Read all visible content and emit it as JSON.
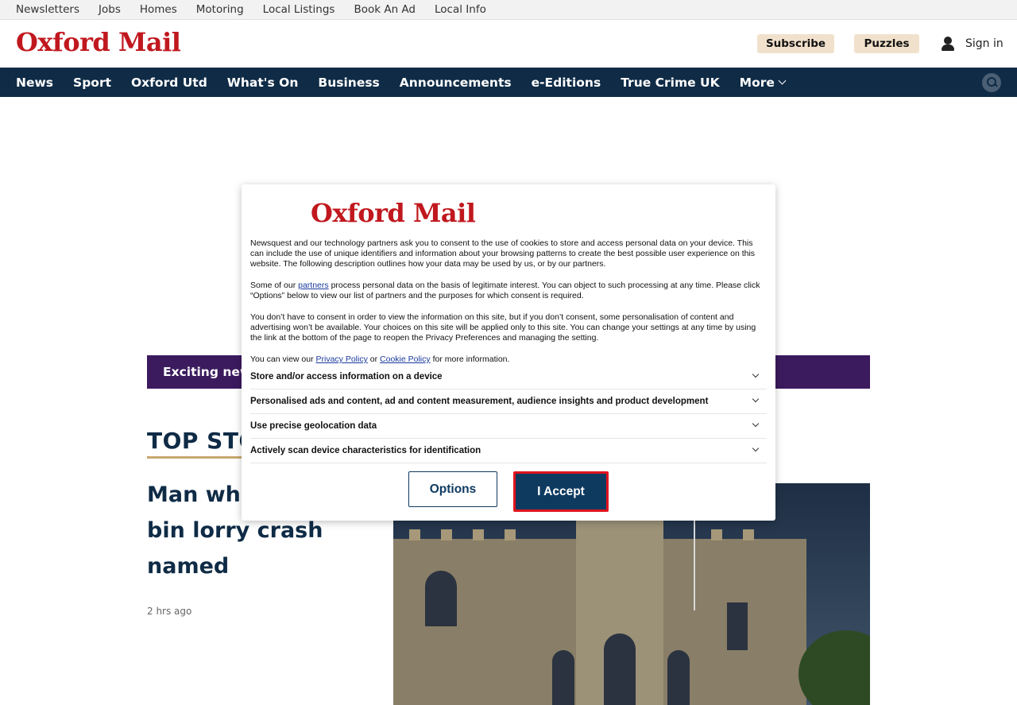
{
  "utility_nav": [
    "Newsletters",
    "Jobs",
    "Homes",
    "Motoring",
    "Local Listings",
    "Book An Ad",
    "Local Info"
  ],
  "header": {
    "logo": "Oxford Mail",
    "subscribe_label": "Subscribe",
    "puzzles_label": "Puzzles",
    "signin_label": "Sign in"
  },
  "main_nav": {
    "items": [
      "News",
      "Sport",
      "Oxford Utd",
      "What's On",
      "Business",
      "Announcements",
      "e-Editions",
      "True Crime UK"
    ],
    "more_label": "More"
  },
  "banner": {
    "text": "Exciting new"
  },
  "top_stories": {
    "title": "TOP STO",
    "headline": "Man who bin lorry crash named",
    "headline_line1": "Man who",
    "headline_line2": "bin lorry crash",
    "headline_line3": "named",
    "timestamp": "2 hrs ago"
  },
  "consent": {
    "logo": "Oxford Mail",
    "para1": "Newsquest and our technology partners ask you to consent to the use of cookies to store and access personal data on your device. This can include the use of unique identifiers and information about your browsing patterns to create the best possible user experience on this website. The following description outlines how your data may be used by us, or by our partners.",
    "para2_before": "Some of our ",
    "para2_link": "partners",
    "para2_after": " process personal data on the basis of legitimate interest. You can object to such processing at any time. Please click “Options” below to view our list of partners and the purposes for which consent is required.",
    "para3": "You don’t have to consent in order to view the information on this site, but if you don’t consent, some personalisation of content and advertising won’t be available. Your choices on this site will be applied only to this site. You can change your settings at any time by using the link at the bottom of the page to reopen the Privacy Preferences and managing the setting.",
    "para4_before": "You can view our ",
    "privacy_link": "Privacy Policy",
    "para4_or": " or ",
    "cookie_link": "Cookie Policy",
    "para4_after": " for more information.",
    "purposes": [
      "Store and/or access information on a device",
      "Personalised ads and content, ad and content measurement, audience insights and product development",
      "Use precise geolocation data",
      "Actively scan device characteristics for identification"
    ],
    "options_label": "Options",
    "accept_label": "I Accept"
  },
  "colors": {
    "brand_red": "#c0181e",
    "nav_navy": "#0f2b46",
    "button_navy": "#0f3a60",
    "banner_purple": "#3b1a5e",
    "pill_beige": "#f1e1cc",
    "highlight_red": "#e0141e"
  }
}
